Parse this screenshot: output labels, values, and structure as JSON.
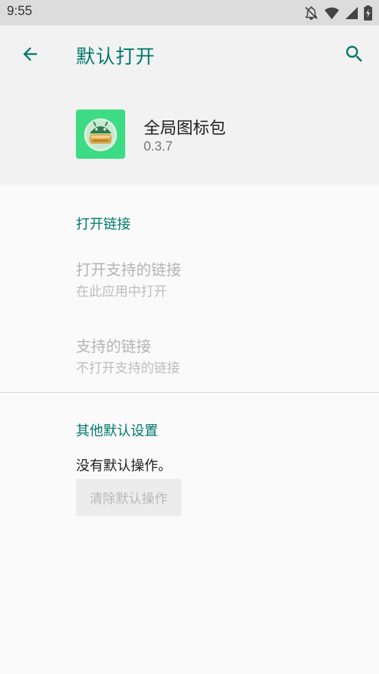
{
  "status_bar": {
    "time": "9:55",
    "icons": [
      "notifications-off-icon",
      "wifi-icon",
      "signal-icon",
      "battery-charging-icon"
    ]
  },
  "app_bar": {
    "title": "默认打开",
    "back_icon": "arrow-back-icon",
    "search_icon": "search-icon"
  },
  "app_header": {
    "name": "全局图标包",
    "version": "0.3.7",
    "icon": "android-robot-icon"
  },
  "open_links": {
    "header": "打开链接",
    "open_supported": {
      "title": "打开支持的链接",
      "summary": "在此应用中打开"
    },
    "supported_links": {
      "title": "支持的链接",
      "summary": "不打开支持的链接"
    }
  },
  "other_defaults": {
    "header": "其他默认设置",
    "message": "没有默认操作。",
    "clear_button": "清除默认操作"
  },
  "colors": {
    "accent": "#00796b",
    "status_bar": "#dcdcdc",
    "app_bar": "#f2f2f2",
    "background": "#fafafa",
    "app_icon_bg": "#3ddc84"
  }
}
